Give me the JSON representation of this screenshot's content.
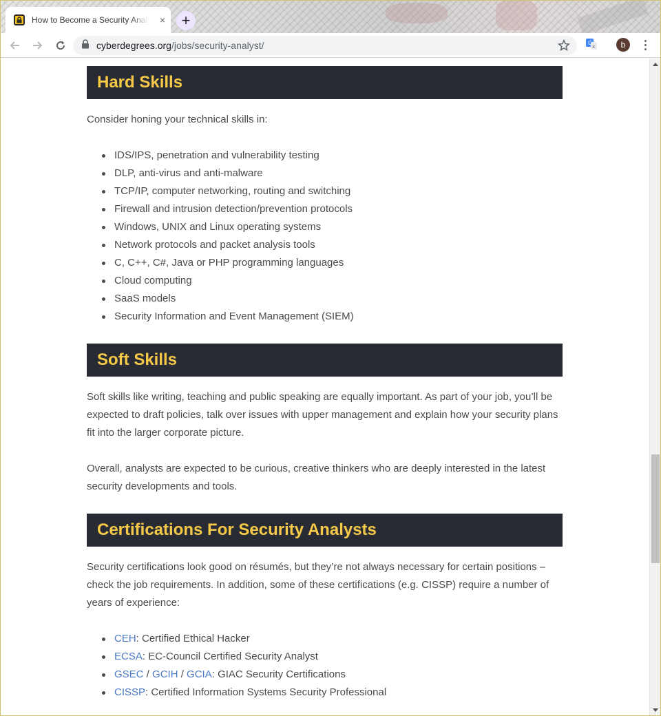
{
  "browser": {
    "tab_title": "How to Become a Security Analyst",
    "tab_close": "×",
    "new_tab": "+",
    "url_domain": "cyberdegrees.org",
    "url_path": "/jobs/security-analyst/",
    "profile_initial": "b"
  },
  "sections": {
    "hard": {
      "heading": "Hard Skills",
      "intro": "Consider honing your technical skills in:",
      "items": [
        "IDS/IPS, penetration and vulnerability testing",
        "DLP, anti-virus and anti-malware",
        "TCP/IP, computer networking, routing and switching",
        "Firewall and intrusion detection/prevention protocols",
        "Windows, UNIX and Linux operating systems",
        "Network protocols and packet analysis tools",
        "C, C++, C#, Java or PHP programming languages",
        "Cloud computing",
        "SaaS models",
        "Security Information and Event Management (SIEM)"
      ]
    },
    "soft": {
      "heading": "Soft Skills",
      "para1": "Soft skills like writing, teaching and public speaking are equally important. As part of your job, you’ll be expected to draft policies, talk over issues with upper management and explain how your security plans fit into the larger corporate picture.",
      "para2": "Overall, analysts are expected to be curious, creative thinkers who are deeply interested in the latest security developments and tools."
    },
    "certs": {
      "heading": "Certifications For Security Analysts",
      "intro": "Security certifications look good on résumés, but they’re not always necessary for certain positions – check the job requirements. In addition, some of these certifications (e.g. CISSP) require a number of years of experience:",
      "ceh_link": "CEH",
      "ceh_desc": ": Certified Ethical Hacker",
      "ecsa_link": "ECSA",
      "ecsa_desc": ": EC-Council Certified Security Analyst",
      "gsec_link": "GSEC",
      "gcih_link": "GCIH",
      "gcia_link": "GCIA",
      "slash": " / ",
      "giac_desc": ": GIAC Security Certifications",
      "cissp_link": "CISSP",
      "cissp_desc": ": Certified Information Systems Security Professional"
    }
  },
  "colors": {
    "heading_bg": "#282b33",
    "heading_text": "#f7c948",
    "link": "#4a78c2"
  }
}
